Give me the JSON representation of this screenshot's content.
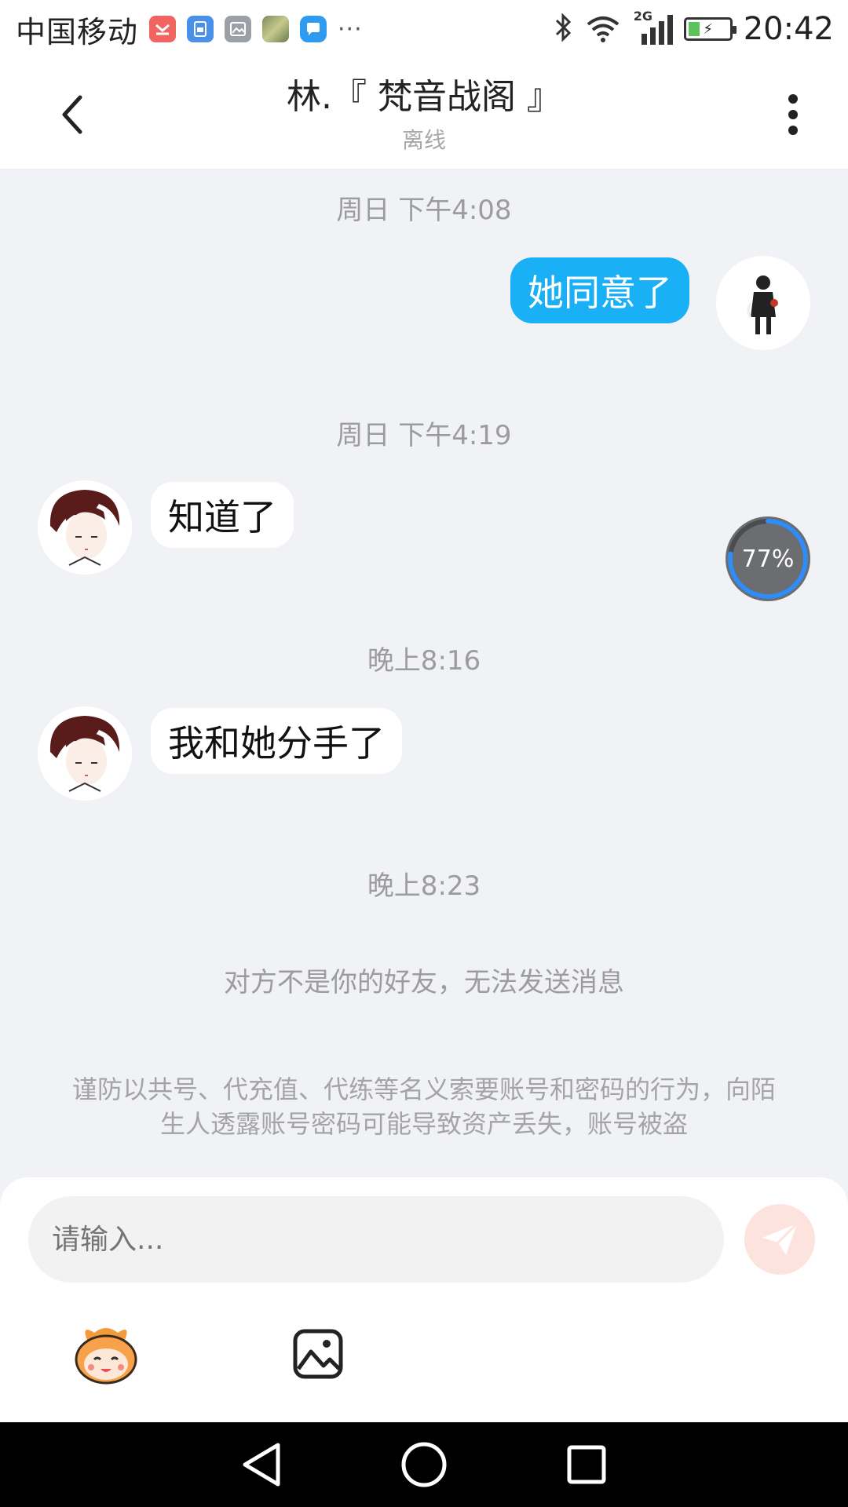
{
  "status_bar": {
    "carrier": "中国移动",
    "notifications": [
      "missed-call-icon",
      "sim-icon",
      "gallery-icon",
      "image-thumbnail-icon",
      "chat-icon"
    ],
    "more": "···",
    "network": "2G",
    "time": "20:42"
  },
  "header": {
    "title": "林.『 梵音战阁 』",
    "subtitle": "离线"
  },
  "messages": [
    {
      "timestamp": "周日 下午4:08",
      "direction": "out",
      "text": "她同意了"
    },
    {
      "timestamp": "周日 下午4:19",
      "direction": "in",
      "text": "知道了"
    },
    {
      "timestamp": "晚上8:16",
      "direction": "in",
      "text": "我和她分手了"
    },
    {
      "timestamp": "晚上8:23"
    }
  ],
  "progress": {
    "value": 77,
    "label": "77%"
  },
  "system_notice": "对方不是你的好友，无法发送消息",
  "warning": "谨防以共号、代充值、代练等名义索要账号和密码的行为，向陌生人透露账号密码可能导致资产丢失，账号被盗",
  "input": {
    "placeholder": "请输入..."
  },
  "colors": {
    "accent": "#1ab0f5",
    "background": "#f1f2f6",
    "send_button_disabled": "#fde3dd",
    "progress_ring": "#2f8df5"
  }
}
